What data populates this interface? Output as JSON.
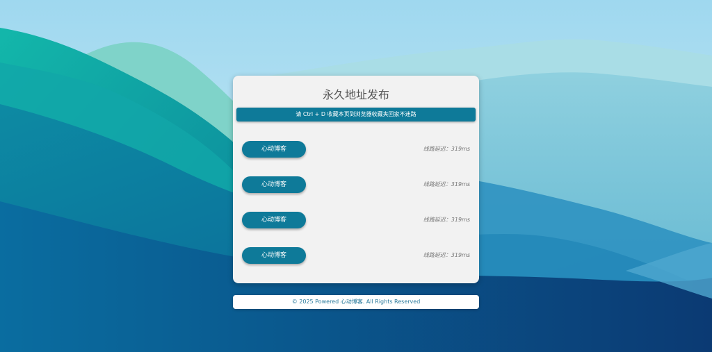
{
  "card": {
    "title": "永久地址发布",
    "notice": "请 Ctrl + D 收藏本页到浏览器收藏夹回家不迷路"
  },
  "links": [
    {
      "label": "心动博客",
      "latency": "线路延迟：319ms"
    },
    {
      "label": "心动博客",
      "latency": "线路延迟：319ms"
    },
    {
      "label": "心动博客",
      "latency": "线路延迟：319ms"
    },
    {
      "label": "心动博客",
      "latency": "线路延迟：319ms"
    }
  ],
  "footer": {
    "text": "© 2025 Powered 心动博客. All Rights Reserved"
  },
  "colors": {
    "accent": "#0e7a99",
    "card_bg": "#f2f2f2",
    "sky_top": "#9fd8ef",
    "deep_blue": "#0b3a73"
  }
}
